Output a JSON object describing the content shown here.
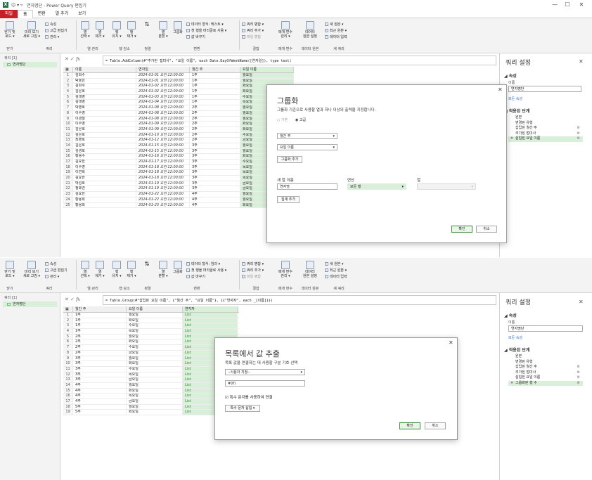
{
  "window": {
    "title": "연자명단 - Power Query 편집기",
    "min": "—",
    "max": "☐",
    "close": "✕",
    "quick": "😊 ▾ ▿"
  },
  "tabs": [
    "파일",
    "홈",
    "변환",
    "열 추가",
    "보기"
  ],
  "ribbon": {
    "close_load": "닫기 및\n로드 ▾",
    "preview": "미리 보기\n새로 고침 ▾",
    "props": "속성",
    "adv": "고급 편집기",
    "manage": "관리 ▾",
    "choose_cols": "열\n선택 ▾",
    "remove_cols": "열\n제거 ▾",
    "keep_rows": "행\n유지 ▾",
    "remove_rows": "행\n제거 ▾",
    "split": "열\n분할 ▾",
    "groupby": "그룹화",
    "datatype": "데이터 형식: 텍스트 ▾",
    "first_header": "첫 행을 머리글로 사용 ▾",
    "replace": "값 바꾸기",
    "merge_q": "쿼리 병합 ▾",
    "append_q": "쿼리 추가 ▾",
    "combine": "파일 병합",
    "params": "매개 변수\n관리 ▾",
    "ds": "데이터\n원본 설정",
    "new_src": "새 원본 ▾",
    "recent": "최근 원본 ▾",
    "enter": "데이터 입력",
    "g_close": "닫기",
    "g_query": "쿼리",
    "g_cols": "열 관리",
    "g_rows": "행 감소",
    "g_sort": "정렬",
    "g_trans": "변환",
    "g_comb": "결합",
    "g_param": "매개 변수",
    "g_ds": "데이터 원본",
    "g_new": "새 쿼리"
  },
  "ribbon2": {
    "datatype": "데이터 형식: 임의 ▾",
    "replace": "값 바꾸기"
  },
  "nav": {
    "title": "쿼리 [1]",
    "item": "연자명단"
  },
  "formula1": "= Table.AddColumn(#\"추가된 접미사\", \"요일 이름\", each Date.DayOfWeekName([연자일]), type text)",
  "formula2": "= Table.Group(#\"삽입된 요일 이름\", {\"월간 주\", \"요일 이름\"}, {{\"연자자\", each _[이름]}})",
  "grid1": {
    "headers": [
      "이름",
      "연자일",
      "월간 주",
      "요일 이름"
    ],
    "rows": [
      [
        "김희수",
        "2024-01-01 오전 12:00:00",
        "1주",
        "월요일"
      ],
      [
        "박호민",
        "2024-01-01 오전 12:00:00",
        "1주",
        "월요일"
      ],
      [
        "김희수",
        "2024-01-02 오전 12:00:00",
        "1주",
        "화요일"
      ],
      [
        "김은호",
        "2024-01-02 오전 12:00:00",
        "1주",
        "화요일"
      ],
      [
        "김대영",
        "2024-01-03 오전 12:00:00",
        "1주",
        "수요일"
      ],
      [
        "김대영",
        "2024-01-04 오전 12:00:00",
        "1주",
        "목요일"
      ],
      [
        "박영호",
        "2024-01-08 오전 12:00:00",
        "2주",
        "월요일"
      ],
      [
        "이수영",
        "2024-01-08 오전 12:00:00",
        "2주",
        "월요일"
      ],
      [
        "이경철",
        "2024-01-08 오전 12:00:00",
        "2주",
        "월요일"
      ],
      [
        "이수영",
        "2024-01-09 오전 12:00:00",
        "2주",
        "화요일"
      ],
      [
        "김은호",
        "2024-01-09 오전 12:00:00",
        "2주",
        "화요일"
      ],
      [
        "김은호",
        "2024-01-10 오전 12:00:00",
        "2주",
        "수요일"
      ],
      [
        "최영호",
        "2024-01-12 오전 12:00:00",
        "2주",
        "금요일"
      ],
      [
        "김은호",
        "2024-01-15 오전 12:00:00",
        "3주",
        "월요일"
      ],
      [
        "김경호",
        "2024-01-15 오전 12:00:00",
        "3주",
        "월요일"
      ],
      [
        "황용수",
        "2024-01-16 오전 12:00:00",
        "3주",
        "화요일"
      ],
      [
        "김요한",
        "2024-01-17 오전 12:00:00",
        "3주",
        "수요일"
      ],
      [
        "이수영",
        "2024-01-18 오전 12:00:00",
        "3주",
        "목요일"
      ],
      [
        "이연희",
        "2024-01-18 오전 12:00:00",
        "3주",
        "목요일"
      ],
      [
        "김요한",
        "2024-01-18 오전 12:00:00",
        "3주",
        "목요일"
      ],
      [
        "박성호",
        "2024-01-19 오전 12:00:00",
        "3주",
        "금요일"
      ],
      [
        "정호연",
        "2024-01-19 오전 12:00:00",
        "3주",
        "금요일"
      ],
      [
        "김요한",
        "2024-01-22 오전 12:00:00",
        "4주",
        "월요일"
      ],
      [
        "황용희",
        "2024-01-22 오전 12:00:00",
        "4주",
        "월요일"
      ],
      [
        "황용희",
        "2024-01-23 오전 12:00:00",
        "4주",
        "화요일"
      ]
    ]
  },
  "grid2": {
    "headers": [
      "월간 주",
      "요일 이름",
      "연자자"
    ],
    "rows": [
      [
        "1주",
        "월요일",
        "List"
      ],
      [
        "1주",
        "화요일",
        "List"
      ],
      [
        "1주",
        "수요일",
        "List"
      ],
      [
        "1주",
        "목요일",
        "List"
      ],
      [
        "2주",
        "월요일",
        "List"
      ],
      [
        "2주",
        "화요일",
        "List"
      ],
      [
        "2주",
        "수요일",
        "List"
      ],
      [
        "2주",
        "금요일",
        "List"
      ],
      [
        "3주",
        "월요일",
        "List"
      ],
      [
        "3주",
        "화요일",
        "List"
      ],
      [
        "3주",
        "수요일",
        "List"
      ],
      [
        "3주",
        "목요일",
        "List"
      ],
      [
        "3주",
        "금요일",
        "List"
      ],
      [
        "4주",
        "월요일",
        "List"
      ],
      [
        "4주",
        "화요일",
        "List"
      ],
      [
        "4주",
        "목요일",
        "List"
      ],
      [
        "4주",
        "금요일",
        "List"
      ],
      [
        "5주",
        "월요일",
        "List"
      ],
      [
        "5주",
        "화요일",
        "List"
      ]
    ]
  },
  "settings": {
    "title": "쿼리 설정",
    "props": "속성",
    "name_label": "이름",
    "name": "연자명단",
    "all_props": "모든 속성",
    "steps_title": "적용된 단계",
    "steps1": [
      "원본",
      "변경된 유형",
      "삽입된 월간 주",
      "추가된 접미사",
      "삽입된 요일 이름"
    ],
    "steps2": [
      "원본",
      "변경된 유형",
      "삽입된 월간 주",
      "추가된 접미사",
      "삽입된 요일 이름",
      "그룹화된 행 수"
    ]
  },
  "group_dialog": {
    "title": "그룹화",
    "desc": "그룹화 기준으로 사용할 열과 하나 이상의 출력을 지정합니다.",
    "basic": "기본",
    "advanced": "고급",
    "col1": "월간 주",
    "col2": "요일 이름",
    "add_group": "그룹화 추가",
    "newcol_label": "새 열 이름",
    "op_label": "연산",
    "col_label": "열",
    "newcol": "연자명",
    "op": "모든 행",
    "add_agg": "집계 추가",
    "ok": "확인",
    "cancel": "취소"
  },
  "extract_dialog": {
    "title": "목록에서 값 추출",
    "desc": "목록 값을 연결하는 데 사용할 구분 기호 선택",
    "delim": "--사용자 지정--",
    "value": "#(lf)",
    "special_chk": "특수 문자를 사용하여 연결",
    "insert_special": "특수 문자 삽입",
    "ok": "확인",
    "cancel": "취소"
  }
}
